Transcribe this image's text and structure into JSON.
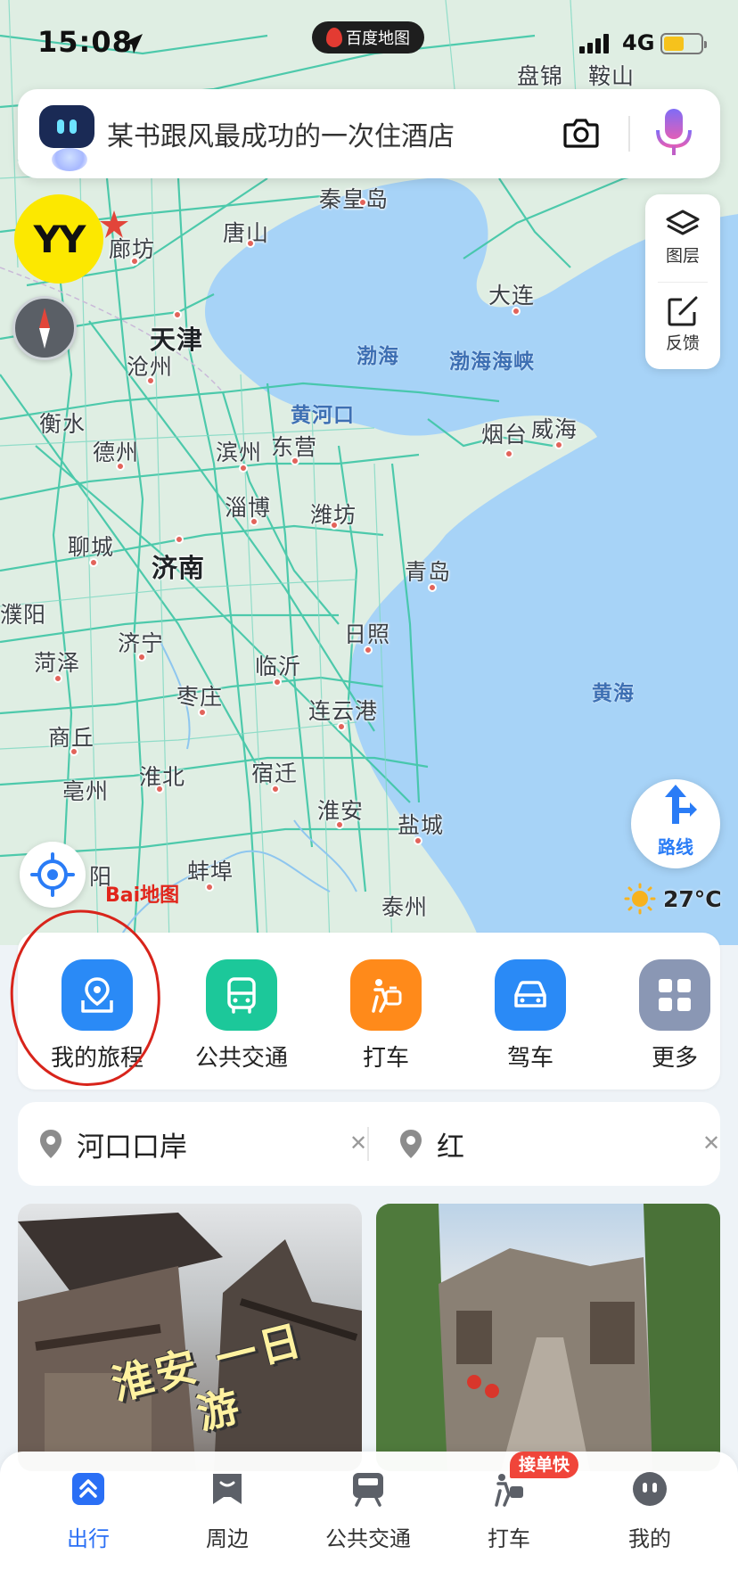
{
  "status_bar": {
    "time": "15:08",
    "app_pill": "百度地图",
    "network": "4G"
  },
  "search": {
    "placeholder_text": "某书跟风最成功的一次住酒店",
    "icons": [
      "robot-assistant-icon",
      "camera-icon",
      "microphone-icon"
    ]
  },
  "map": {
    "cities": [
      {
        "name": "秦皇岛"
      },
      {
        "name": "唐山"
      },
      {
        "name": "廊坊"
      },
      {
        "name": "天津"
      },
      {
        "name": "沧州"
      },
      {
        "name": "衡水"
      },
      {
        "name": "德州"
      },
      {
        "name": "滨州"
      },
      {
        "name": "东营"
      },
      {
        "name": "淄博"
      },
      {
        "name": "潍坊"
      },
      {
        "name": "聊城"
      },
      {
        "name": "济南"
      },
      {
        "name": "青岛"
      },
      {
        "name": "烟台"
      },
      {
        "name": "威海"
      },
      {
        "name": "大连"
      },
      {
        "name": "济宁"
      },
      {
        "name": "菏泽"
      },
      {
        "name": "日照"
      },
      {
        "name": "临沂"
      },
      {
        "name": "枣庄"
      },
      {
        "name": "连云港"
      },
      {
        "name": "商丘"
      },
      {
        "name": "亳州"
      },
      {
        "name": "淮北"
      },
      {
        "name": "宿迁"
      },
      {
        "name": "淮安"
      },
      {
        "name": "盐城"
      },
      {
        "name": "蚌埠"
      },
      {
        "name": "泰州"
      },
      {
        "name": "濮阳"
      },
      {
        "name": "盘锦"
      },
      {
        "name": "鞍山"
      },
      {
        "name": "阳"
      }
    ],
    "seas": [
      {
        "name": "渤海"
      },
      {
        "name": "渤海海峡"
      },
      {
        "name": "黄河口"
      },
      {
        "name": "黄海"
      }
    ],
    "logo": "Bai地图",
    "yy_badge": "YY"
  },
  "right_panel": {
    "layers_label": "图层",
    "feedback_label": "反馈",
    "route_label": "路线"
  },
  "weather": {
    "temperature": "27°C"
  },
  "shortcuts": [
    {
      "label": "我的旅程",
      "icon": "trip-pin-icon",
      "color": "#2a8af6"
    },
    {
      "label": "公共交通",
      "icon": "bus-icon",
      "color": "#1cc89a"
    },
    {
      "label": "打车",
      "icon": "taxi-icon",
      "color": "#ff8a1a"
    },
    {
      "label": "驾车",
      "icon": "car-icon",
      "color": "#2a8af6"
    },
    {
      "label": "更多",
      "icon": "grid-icon",
      "color": "#8a97b4"
    }
  ],
  "recent": [
    {
      "text": "河口口岸"
    },
    {
      "text": "红"
    }
  ],
  "cards": [
    {
      "title": "淮安 一日游"
    },
    {
      "title": ""
    }
  ],
  "tabbar": [
    {
      "label": "出行",
      "active": true
    },
    {
      "label": "周边"
    },
    {
      "label": "公共交通"
    },
    {
      "label": "打车",
      "badge": "接单快"
    },
    {
      "label": "我的"
    }
  ]
}
